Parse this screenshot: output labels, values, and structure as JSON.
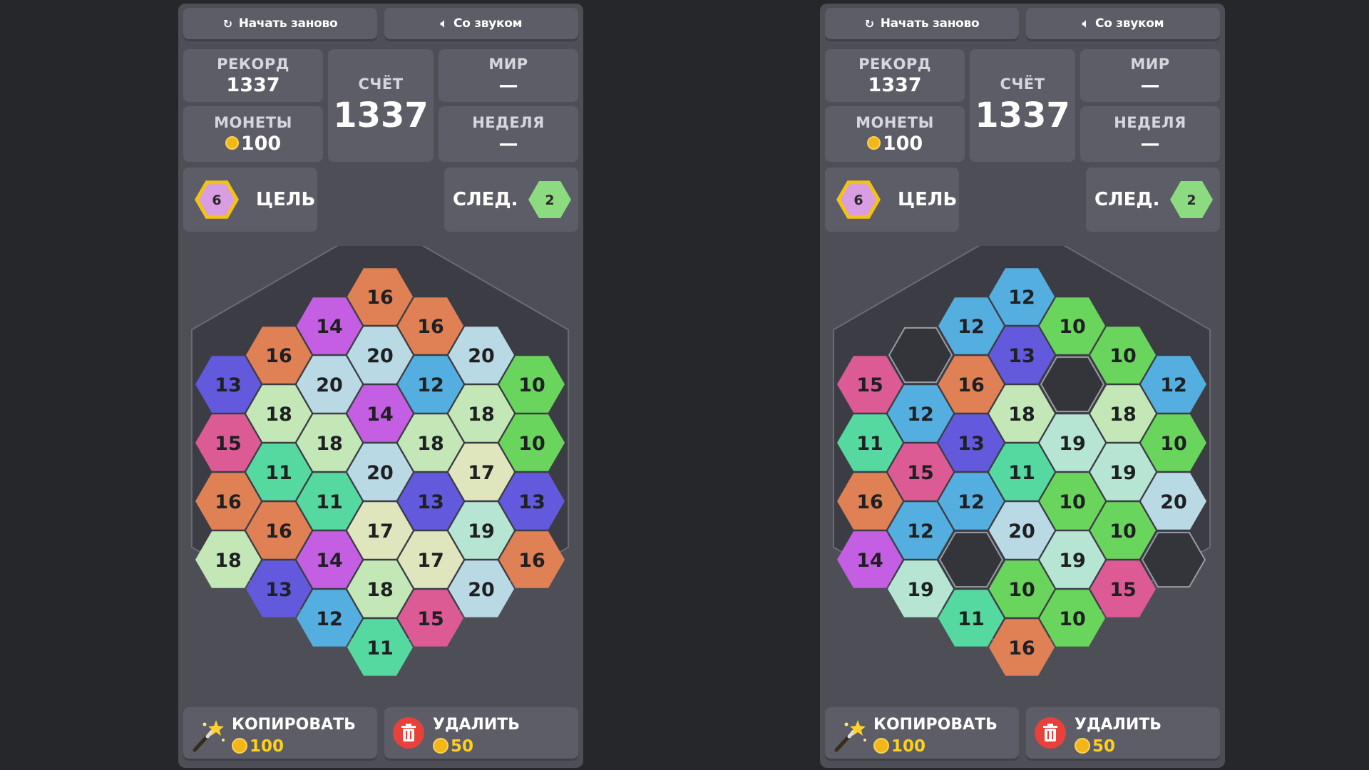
{
  "boards": [
    {
      "restart_label": "Начать заново",
      "sound_label": "Со звуком",
      "record_label": "РЕКОРД",
      "record_value": "1337",
      "coins_label": "МОНЕТЫ",
      "coins_value": "100",
      "score_label": "СЧЁТ",
      "score_value": "1337",
      "world_label": "МИР",
      "world_value": "—",
      "week_label": "НЕДЕЛЯ",
      "week_value": "—",
      "target_value": "6",
      "target_label": "ЦЕЛЬ",
      "next_label": "СЛЕД.",
      "next_value": "2",
      "copy_label": "КОПИРОВАТЬ",
      "copy_price": "100",
      "delete_label": "УДАЛИТЬ",
      "delete_price": "50",
      "cells": [
        [
          18,
          13,
          12,
          11
        ],
        [
          16,
          16,
          14,
          18,
          15
        ],
        [
          15,
          11,
          11,
          17,
          17,
          20
        ],
        [
          13,
          18,
          18,
          20,
          13,
          19,
          16
        ],
        [
          16,
          20,
          14,
          18,
          17,
          13
        ],
        [
          14,
          20,
          12,
          18,
          10
        ],
        [
          16,
          20,
          10
        ],
        [
          16
        ]
      ]
    },
    {
      "restart_label": "Начать заново",
      "sound_label": "Со звуком",
      "record_label": "РЕКОРД",
      "record_value": "1337",
      "coins_label": "МОНЕТЫ",
      "coins_value": "100",
      "score_label": "СЧЁТ",
      "score_value": "1337",
      "world_label": "МИР",
      "world_value": "—",
      "week_label": "НЕДЕЛЯ",
      "week_value": "—",
      "target_value": "6",
      "target_label": "ЦЕЛЬ",
      "next_label": "СЛЕД.",
      "next_value": "2",
      "copy_label": "КОПИРОВАТЬ",
      "copy_price": "100",
      "delete_label": "УДАЛИТЬ",
      "delete_price": "50",
      "cells": null
    }
  ],
  "colors": {
    "10": "#6ad55d",
    "11": "#55d9a1",
    "12": "#55aee0",
    "13": "#6259dd",
    "14": "#c45ee3",
    "15": "#dd5b95",
    "16": "#e08055",
    "17": "#dfe5bc",
    "18": "#c3e7b7",
    "19": "#b7e5d4",
    "20": "#b9d9e5",
    "target": "#d89de3",
    "next": "#8ddb80"
  }
}
